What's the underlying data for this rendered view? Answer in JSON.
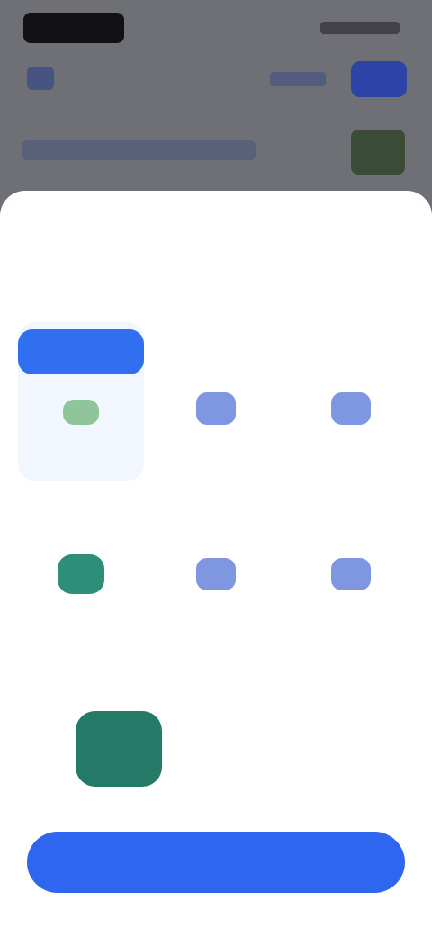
{
  "underlay": {
    "top_link_label": "",
    "top_button_label": "",
    "body_text": ""
  },
  "sheet": {
    "title": "",
    "subtitle": "",
    "options": [
      {
        "tag": "",
        "label": "",
        "icon": "document-icon",
        "selected": true
      },
      {
        "tag": "",
        "label": "",
        "icon": "circle-icon",
        "selected": false
      },
      {
        "tag": "",
        "label": "",
        "icon": "circle-icon",
        "selected": false
      },
      {
        "tag": "",
        "label": "",
        "icon": "globe-icon",
        "selected": false
      },
      {
        "tag": "",
        "label": "",
        "icon": "circle-icon",
        "selected": false
      },
      {
        "tag": "",
        "label": "",
        "icon": "circle-icon",
        "selected": false
      }
    ],
    "note": "",
    "feature_label": "",
    "cta_label": ""
  },
  "colors": {
    "accent": "#2f66f0",
    "selected_tint": "#f2f6fe",
    "icon_blue": "#7e97e0",
    "feature_green": "#237a67"
  }
}
